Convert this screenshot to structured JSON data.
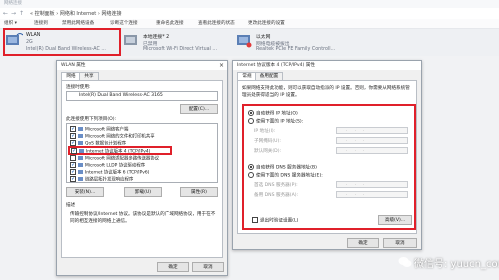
{
  "window": {
    "title": "网络连接"
  },
  "address": {
    "back": "←",
    "forward": "→",
    "up": "↑",
    "breadcrumb": "« 控制面板 › 网络和 Internet › 网络连接"
  },
  "commands": [
    "组织 ▾",
    "连接到",
    "禁用此网络设备",
    "诊断这个连接",
    "重命名此连接",
    "查看此连接的状态",
    "更改此连接的设置"
  ],
  "adapters": [
    {
      "name": "WLAN",
      "status": "2G",
      "device": "Intel(R) Dual Band Wireless-AC ..."
    },
    {
      "name": "本地连接* 2",
      "status": "已禁用",
      "device": "Microsoft Wi-Fi Direct Virtual ..."
    },
    {
      "name": "以太网",
      "status": "网络电缆被拔出",
      "device": "Realtek PCIe FE Family Controll..."
    }
  ],
  "wlan_dialog": {
    "title": "WLAN 属性",
    "close": "×",
    "tabs": [
      "网络",
      "共享"
    ],
    "connect_using_label": "连接时使用:",
    "adapter_name": "Intel(R) Dual Band Wireless-AC 3165",
    "configure_button": "配置(C)...",
    "items_label": "此连接使用下列项目(O):",
    "items": [
      {
        "label": "Microsoft 网络客户端",
        "checked": true
      },
      {
        "label": "Microsoft 网络的文件和打印机共享",
        "checked": true
      },
      {
        "label": "QoS 数据包计划程序",
        "checked": true
      },
      {
        "label": "Internet 协议版本 4 (TCP/IPv4)",
        "checked": true
      },
      {
        "label": "Microsoft 网络适配器多路传送器协议",
        "checked": false
      },
      {
        "label": "Microsoft LLDP 协议驱动程序",
        "checked": true
      },
      {
        "label": "Internet 协议版本 6 (TCP/IPv6)",
        "checked": true
      },
      {
        "label": "链路层拓扑发现响应程序",
        "checked": true
      }
    ],
    "install_button": "安装(N)...",
    "uninstall_button": "卸载(U)",
    "properties_button": "属性(R)",
    "description_label": "描述",
    "description_text": "传输控制协议/Internet 协议。该协议是默认的广域网络协议，用于在不同的相互连接的网络上通信。",
    "ok_button": "确定",
    "cancel_button": "取消"
  },
  "ipv4_dialog": {
    "title": "Internet 协议版本 4 (TCP/IPv4) 属性",
    "tabs": [
      "常规",
      "备用配置"
    ],
    "intro": "如果网络支持此功能，则可以获取自动指派的 IP 设置。否则，你需要从网络系统管理员处获得适当的 IP 设置。",
    "auto_ip": "自动获得 IP 地址(O)",
    "manual_ip": "使用下面的 IP 地址(S):",
    "ip_label": "IP 地址(I):",
    "mask_label": "子网掩码(U):",
    "gateway_label": "默认网关(D):",
    "auto_dns": "自动获得 DNS 服务器地址(B)",
    "manual_dns": "使用下面的 DNS 服务器地址(E):",
    "dns1_label": "首选 DNS 服务器(P):",
    "dns2_label": "备用 DNS 服务器(A):",
    "ip_dots": "...",
    "validate_label": "退出时验证设置(L)",
    "advanced_button": "高级(V)...",
    "ok_button": "确定",
    "cancel_button": "取消"
  },
  "watermark": "微信号: yuucn_com",
  "colors": {
    "highlight": "#e0202a",
    "selection": "#cce8ff"
  }
}
